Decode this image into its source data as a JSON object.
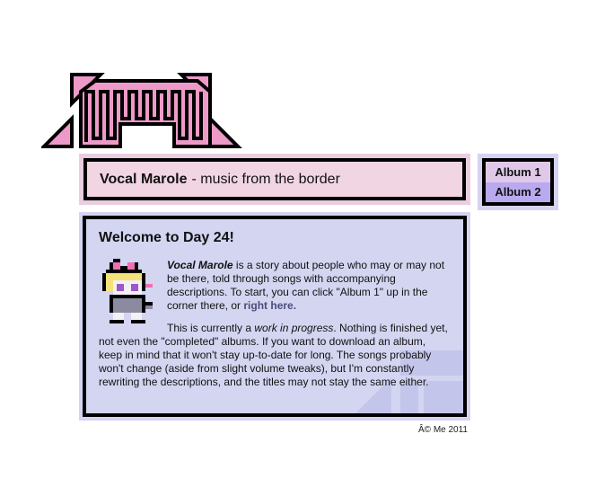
{
  "header": {
    "site_name": "Vocal Marole",
    "tagline": "- music from the border"
  },
  "albums": [
    {
      "label": "Album 1"
    },
    {
      "label": "Album 2"
    }
  ],
  "welcome": {
    "heading": "Welcome to Day 24!",
    "p1_title": "Vocal Marole",
    "p1_text": " is a story about people who may or may not be there, told through songs with accompanying descriptions. To start, you can click \"Album 1\" up in the corner there, or ",
    "p1_link": "right here.",
    "p2_a": "This is currently a ",
    "p2_em": "work in progress",
    "p2_b": ". Nothing is finished yet, not even the \"completed\" albums. If you want to download an album, keep in mind that it won't stay up-to-date for long. The songs probably won't change (aside from slight volume tweaks), but I'm constantly rewriting the descriptions, and the titles may not stay the same either."
  },
  "footer": {
    "copyright": "Â© Me 2011"
  },
  "colors": {
    "logo_pink": "#ee9ac9",
    "title_bg": "#f2d5e3",
    "main_bg": "#d3d5f1",
    "album1_bg": "#e0c9e8",
    "album2_bg": "#b9a9ee"
  },
  "icons": {
    "logo": "pixel-crown-logo-icon",
    "avatar": "pixel-character-with-pink-bow-icon"
  }
}
